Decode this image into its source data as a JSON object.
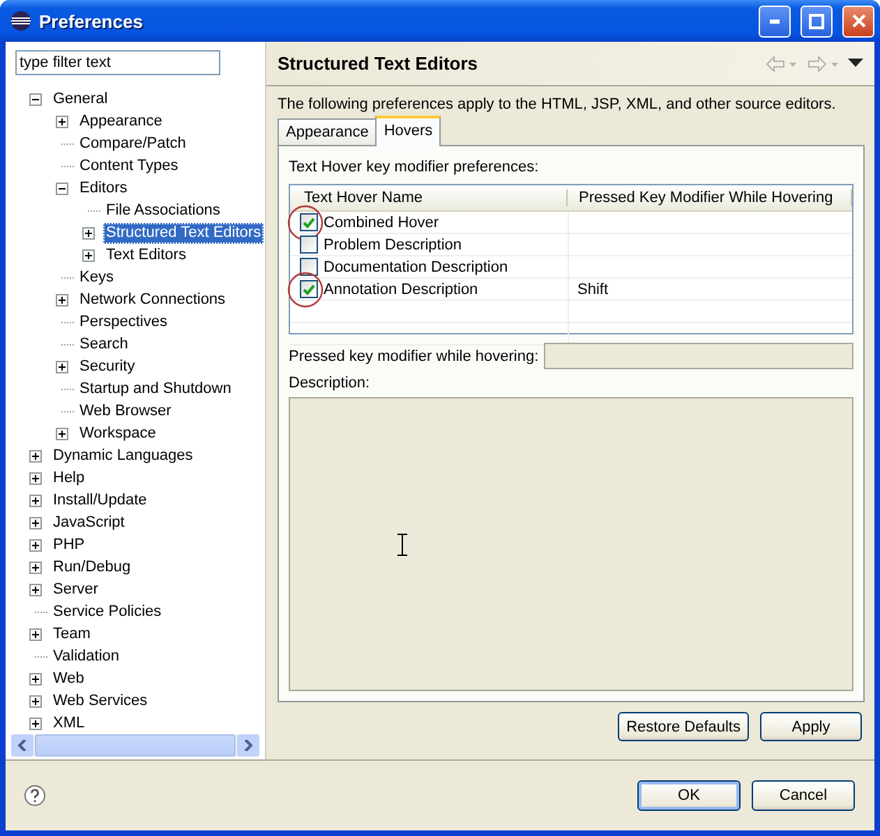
{
  "window": {
    "title": "Preferences"
  },
  "filter": {
    "placeholder": "type filter text"
  },
  "tree": [
    {
      "label": "General",
      "kind": "folder",
      "expanded": true,
      "selected": false,
      "children": [
        {
          "label": "Appearance",
          "kind": "folder",
          "expanded": false,
          "selected": false
        },
        {
          "label": "Compare/Patch",
          "kind": "leaf",
          "selected": false
        },
        {
          "label": "Content Types",
          "kind": "leaf",
          "selected": false
        },
        {
          "label": "Editors",
          "kind": "folder",
          "expanded": true,
          "selected": false,
          "children": [
            {
              "label": "File Associations",
              "kind": "leaf",
              "selected": false
            },
            {
              "label": "Structured Text Editors",
              "kind": "folder",
              "expanded": false,
              "selected": true
            },
            {
              "label": "Text Editors",
              "kind": "folder",
              "expanded": false,
              "selected": false
            }
          ]
        },
        {
          "label": "Keys",
          "kind": "leaf",
          "selected": false
        },
        {
          "label": "Network Connections",
          "kind": "folder",
          "expanded": false,
          "selected": false
        },
        {
          "label": "Perspectives",
          "kind": "leaf",
          "selected": false
        },
        {
          "label": "Search",
          "kind": "leaf",
          "selected": false
        },
        {
          "label": "Security",
          "kind": "folder",
          "expanded": false,
          "selected": false
        },
        {
          "label": "Startup and Shutdown",
          "kind": "leaf",
          "selected": false
        },
        {
          "label": "Web Browser",
          "kind": "leaf",
          "selected": false
        },
        {
          "label": "Workspace",
          "kind": "folder",
          "expanded": false,
          "selected": false
        }
      ]
    },
    {
      "label": "Dynamic Languages",
      "kind": "folder",
      "expanded": false,
      "selected": false
    },
    {
      "label": "Help",
      "kind": "folder",
      "expanded": false,
      "selected": false
    },
    {
      "label": "Install/Update",
      "kind": "folder",
      "expanded": false,
      "selected": false
    },
    {
      "label": "JavaScript",
      "kind": "folder",
      "expanded": false,
      "selected": false
    },
    {
      "label": "PHP",
      "kind": "folder",
      "expanded": false,
      "selected": false
    },
    {
      "label": "Run/Debug",
      "kind": "folder",
      "expanded": false,
      "selected": false
    },
    {
      "label": "Server",
      "kind": "folder",
      "expanded": false,
      "selected": false
    },
    {
      "label": "Service Policies",
      "kind": "leaf",
      "selected": false
    },
    {
      "label": "Team",
      "kind": "folder",
      "expanded": false,
      "selected": false
    },
    {
      "label": "Validation",
      "kind": "leaf",
      "selected": false
    },
    {
      "label": "Web",
      "kind": "folder",
      "expanded": false,
      "selected": false
    },
    {
      "label": "Web Services",
      "kind": "folder",
      "expanded": false,
      "selected": false
    },
    {
      "label": "XML",
      "kind": "folder",
      "expanded": false,
      "selected": false
    }
  ],
  "page": {
    "title": "Structured Text Editors",
    "intro": "The following preferences apply to the HTML, JSP, XML, and other source editors."
  },
  "tabs": [
    {
      "label": "Appearance",
      "selected": false
    },
    {
      "label": "Hovers",
      "selected": true
    }
  ],
  "hovers": {
    "caption": "Text Hover key modifier preferences:",
    "columns": [
      "Text Hover Name",
      "Pressed Key Modifier While Hovering"
    ],
    "rows": [
      {
        "name": "Combined Hover",
        "checked": true,
        "modifier": "",
        "circled": true
      },
      {
        "name": "Problem Description",
        "checked": false,
        "modifier": "",
        "circled": false
      },
      {
        "name": "Documentation Description",
        "checked": false,
        "modifier": "",
        "circled": false
      },
      {
        "name": "Annotation Description",
        "checked": true,
        "modifier": "Shift",
        "circled": true
      }
    ]
  },
  "modifier_field": {
    "label": "Pressed key modifier while hovering:"
  },
  "description": {
    "label": "Description:"
  },
  "page_buttons": [
    "Restore Defaults",
    "Apply"
  ],
  "dialog_buttons": [
    {
      "label": "OK",
      "default": true
    },
    {
      "label": "Cancel",
      "default": false
    }
  ]
}
